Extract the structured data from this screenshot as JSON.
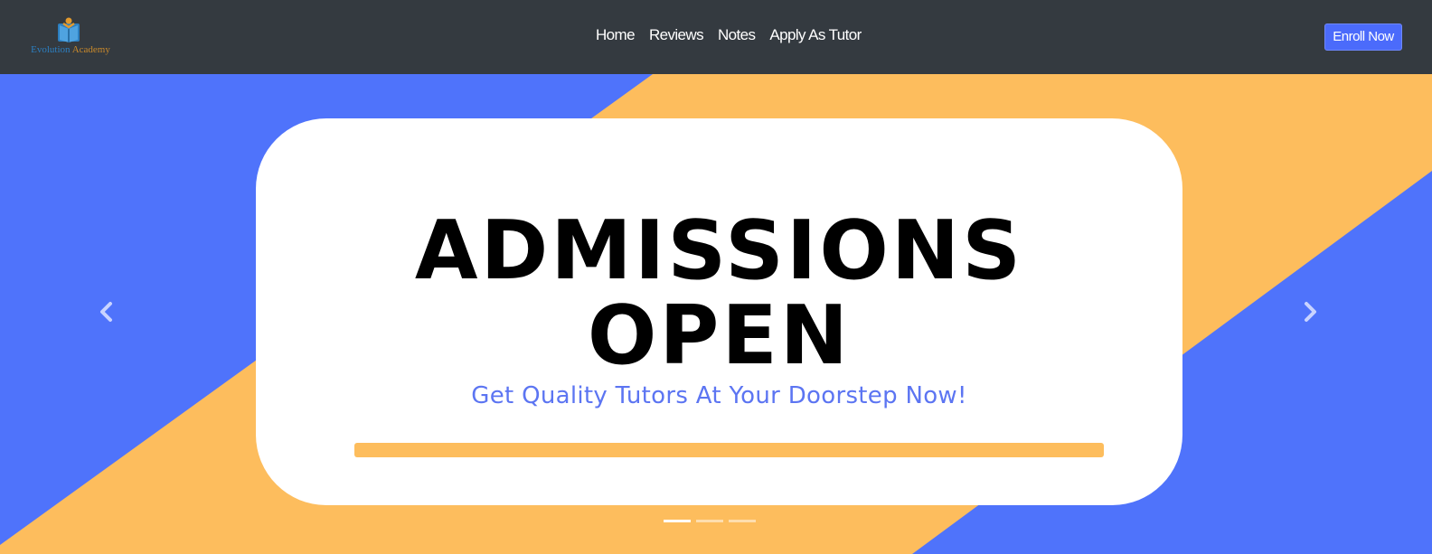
{
  "brand": {
    "name_part1": "Evolution",
    "name_part2": "Academy",
    "icon": "book-person-icon"
  },
  "nav": {
    "links": [
      {
        "label": "Home"
      },
      {
        "label": "Reviews"
      },
      {
        "label": "Notes"
      },
      {
        "label": "Apply As Tutor"
      }
    ],
    "cta_label": "Enroll Now"
  },
  "hero": {
    "headline_line1": "ADMISSIONS",
    "headline_line2": "OPEN",
    "subheading": "Get Quality Tutors At Your Doorstep Now!",
    "slide_count": 3,
    "active_slide": 1,
    "prev_icon": "chevron-left-icon",
    "next_icon": "chevron-right-icon"
  },
  "colors": {
    "navbar_bg": "#343a40",
    "hero_blue": "#4f73fb",
    "hero_orange": "#fdbd5d",
    "accent_text": "#5c75f2",
    "button_bg": "#4b6bfb"
  }
}
